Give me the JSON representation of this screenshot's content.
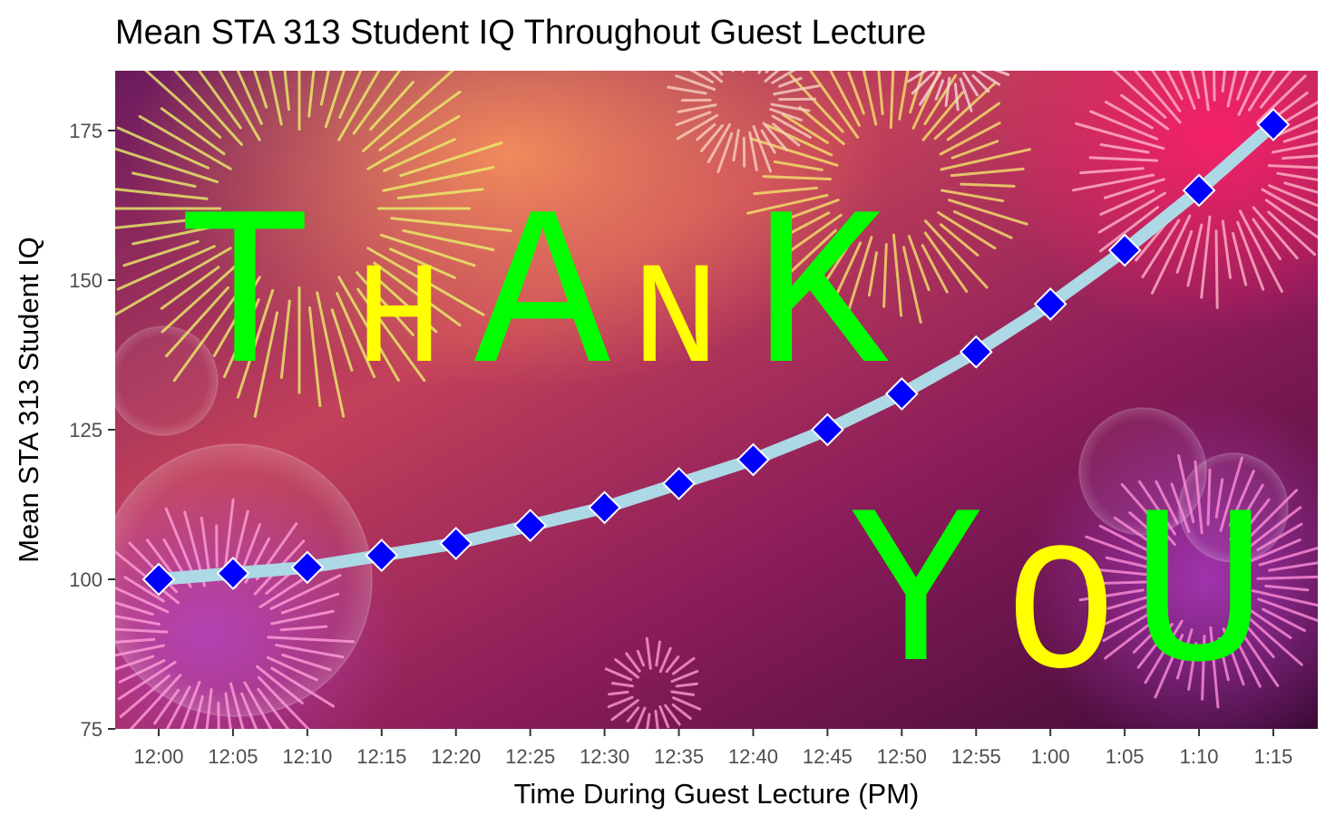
{
  "chart_data": {
    "type": "line",
    "title": "Mean STA 313 Student IQ Throughout Guest Lecture",
    "xlabel": "Time During Guest Lecture (PM)",
    "ylabel": "Mean STA 313 Student IQ",
    "categories": [
      "12:00",
      "12:05",
      "12:10",
      "12:15",
      "12:20",
      "12:25",
      "12:30",
      "12:35",
      "12:40",
      "12:45",
      "12:50",
      "12:55",
      "1:00",
      "1:05",
      "1:10",
      "1:15"
    ],
    "values": [
      100,
      101,
      102,
      104,
      106,
      109,
      112,
      116,
      120,
      125,
      131,
      138,
      146,
      155,
      165,
      176
    ],
    "ylim": [
      75,
      185
    ],
    "yticks": [
      75,
      100,
      125,
      150,
      175
    ],
    "grid": false,
    "line_color": "#add8e6",
    "marker": "diamond",
    "marker_color": "#0000ff",
    "marker_outline": "#ffffff",
    "background": "fireworks"
  },
  "overlay": {
    "letters": [
      {
        "char": "T",
        "color": "#00ff00"
      },
      {
        "char": "H",
        "color": "#ffff00"
      },
      {
        "char": "A",
        "color": "#00ff00"
      },
      {
        "char": "N",
        "color": "#ffff00"
      },
      {
        "char": "K",
        "color": "#00ff00"
      },
      {
        "char": "Y",
        "color": "#00ff00"
      },
      {
        "char": "O",
        "color": "#ffff00"
      },
      {
        "char": "U",
        "color": "#00ff00"
      }
    ]
  }
}
